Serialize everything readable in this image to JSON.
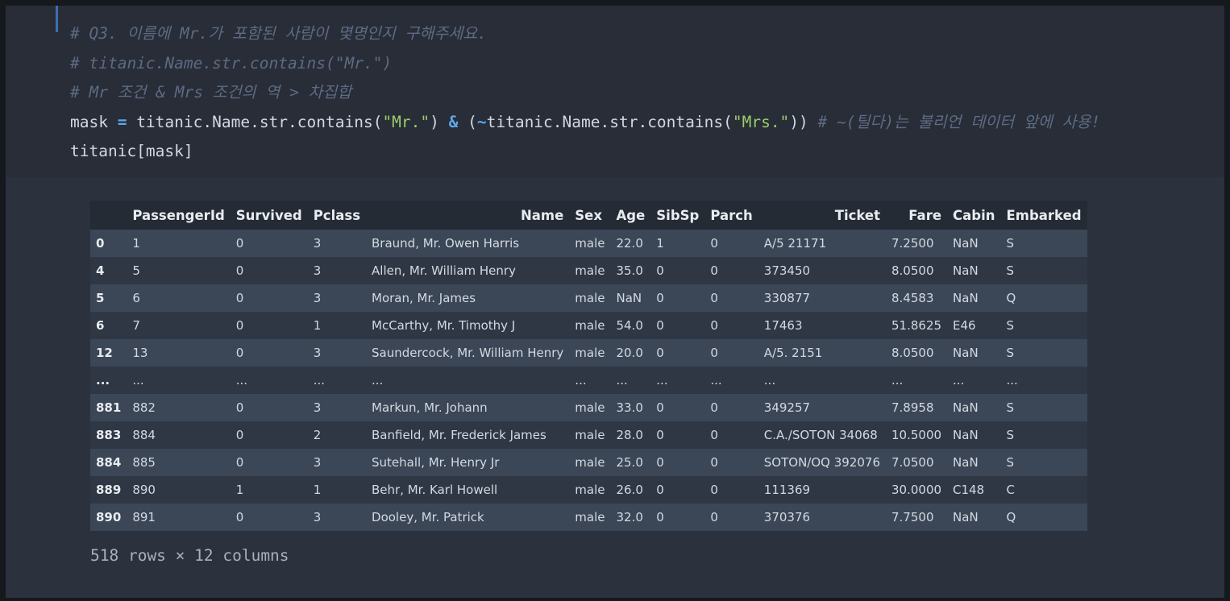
{
  "code_cell": {
    "lines": [
      [
        {
          "t": "# Q3. 이름에 Mr.가 포함된 사람이 몇명인지 구해주세요.",
          "c": "cm"
        }
      ],
      [
        {
          "t": "# titanic.Name.str.contains(\"Mr.\")",
          "c": "cm"
        }
      ],
      [
        {
          "t": "# Mr 조건 & Mrs 조건의 역 > 차집합",
          "c": "cm"
        }
      ],
      [
        {
          "t": "mask ",
          "c": ""
        },
        {
          "t": "=",
          "c": "op"
        },
        {
          "t": " titanic.Name.str.contains(",
          "c": ""
        },
        {
          "t": "\"Mr.\"",
          "c": "str"
        },
        {
          "t": ") ",
          "c": ""
        },
        {
          "t": "&",
          "c": "op"
        },
        {
          "t": " (",
          "c": ""
        },
        {
          "t": "~",
          "c": "op"
        },
        {
          "t": "titanic.Name.str.contains(",
          "c": ""
        },
        {
          "t": "\"Mrs.\"",
          "c": "str"
        },
        {
          "t": ")) ",
          "c": ""
        },
        {
          "t": "# ~(틸다)는 불리언 데이터 앞에 사용!",
          "c": "cm"
        }
      ],
      [
        {
          "t": "titanic[mask]",
          "c": ""
        }
      ]
    ]
  },
  "table": {
    "columns": [
      "",
      "PassengerId",
      "Survived",
      "Pclass",
      "Name",
      "Sex",
      "Age",
      "SibSp",
      "Parch",
      "Ticket",
      "Fare",
      "Cabin",
      "Embarked"
    ],
    "rows": [
      [
        "0",
        "1",
        "0",
        "3",
        "Braund, Mr. Owen Harris",
        "male",
        "22.0",
        "1",
        "0",
        "A/5 21171",
        "7.2500",
        "NaN",
        "S"
      ],
      [
        "4",
        "5",
        "0",
        "3",
        "Allen, Mr. William Henry",
        "male",
        "35.0",
        "0",
        "0",
        "373450",
        "8.0500",
        "NaN",
        "S"
      ],
      [
        "5",
        "6",
        "0",
        "3",
        "Moran, Mr. James",
        "male",
        "NaN",
        "0",
        "0",
        "330877",
        "8.4583",
        "NaN",
        "Q"
      ],
      [
        "6",
        "7",
        "0",
        "1",
        "McCarthy, Mr. Timothy J",
        "male",
        "54.0",
        "0",
        "0",
        "17463",
        "51.8625",
        "E46",
        "S"
      ],
      [
        "12",
        "13",
        "0",
        "3",
        "Saundercock, Mr. William Henry",
        "male",
        "20.0",
        "0",
        "0",
        "A/5. 2151",
        "8.0500",
        "NaN",
        "S"
      ],
      [
        "...",
        "...",
        "...",
        "...",
        "...",
        "...",
        "...",
        "...",
        "...",
        "...",
        "...",
        "...",
        "..."
      ],
      [
        "881",
        "882",
        "0",
        "3",
        "Markun, Mr. Johann",
        "male",
        "33.0",
        "0",
        "0",
        "349257",
        "7.8958",
        "NaN",
        "S"
      ],
      [
        "883",
        "884",
        "0",
        "2",
        "Banfield, Mr. Frederick James",
        "male",
        "28.0",
        "0",
        "0",
        "C.A./SOTON 34068",
        "10.5000",
        "NaN",
        "S"
      ],
      [
        "884",
        "885",
        "0",
        "3",
        "Sutehall, Mr. Henry Jr",
        "male",
        "25.0",
        "0",
        "0",
        "SOTON/OQ 392076",
        "7.0500",
        "NaN",
        "S"
      ],
      [
        "889",
        "890",
        "1",
        "1",
        "Behr, Mr. Karl Howell",
        "male",
        "26.0",
        "0",
        "0",
        "111369",
        "30.0000",
        "C148",
        "C"
      ],
      [
        "890",
        "891",
        "0",
        "3",
        "Dooley, Mr. Patrick",
        "male",
        "32.0",
        "0",
        "0",
        "370376",
        "7.7500",
        "NaN",
        "Q"
      ]
    ]
  },
  "shape_text": "518 rows × 12 columns"
}
